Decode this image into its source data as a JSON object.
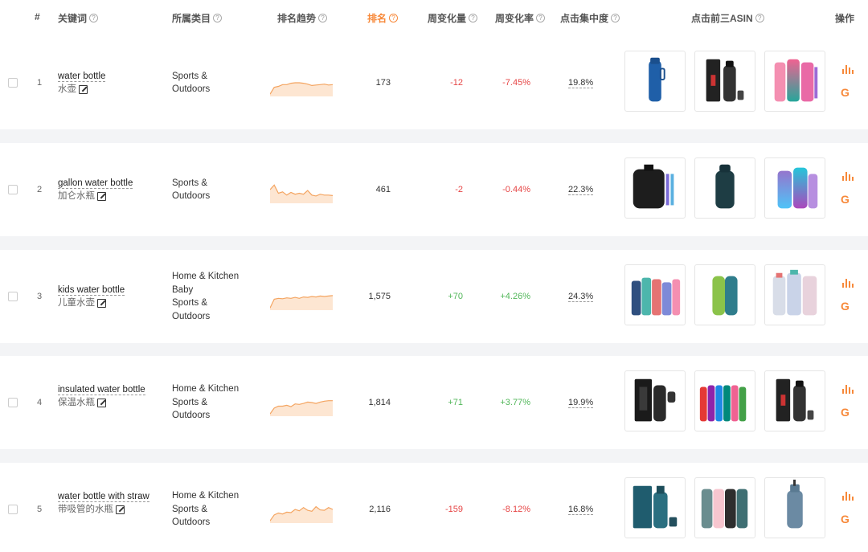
{
  "header": {
    "index": "#",
    "keyword": "关键词",
    "category": "所属类目",
    "trend": "排名趋势",
    "rank": "排名",
    "weekly_change": "周变化量",
    "weekly_rate": "周变化率",
    "click_concentration": "点击集中度",
    "top3_asin": "点击前三ASIN",
    "actions": "操作"
  },
  "icons": {
    "help": "question-circle-icon",
    "edit": "edit-icon",
    "chart": "bar-chart-icon",
    "google": "google-icon"
  },
  "colors": {
    "accent": "#f7893a",
    "negative": "#e64545",
    "positive": "#52b75a",
    "sparkline_stroke": "#f4a460",
    "sparkline_fill": "#fde6d2"
  },
  "rows": [
    {
      "index": "1",
      "keyword": "water bottle",
      "keyword_cn": "水壶",
      "categories": [
        "Sports &",
        "Outdoors"
      ],
      "trend": [
        55,
        40,
        38,
        34,
        34,
        31,
        30,
        30,
        31,
        33,
        36,
        35,
        34,
        33,
        35,
        34
      ],
      "rank": "173",
      "change": "-12",
      "rate": "-7.45%",
      "direction": "negative",
      "concentration": "19.8%",
      "thumbs": [
        "blue-bottle",
        "black-bottle-set",
        "pink-teal-bottles"
      ]
    },
    {
      "index": "2",
      "keyword": "gallon water bottle",
      "keyword_cn": "加仑水瓶",
      "categories": [
        "Sports &",
        "Outdoors"
      ],
      "trend": [
        30,
        20,
        38,
        35,
        42,
        36,
        40,
        38,
        40,
        32,
        42,
        44,
        40,
        42,
        42,
        43
      ],
      "rank": "461",
      "change": "-2",
      "rate": "-0.44%",
      "direction": "negative",
      "concentration": "22.3%",
      "thumbs": [
        "gallon-jug",
        "dark-teal-bottle",
        "gradient-bottles"
      ]
    },
    {
      "index": "3",
      "keyword": "kids water bottle",
      "keyword_cn": "儿童水壶",
      "categories": [
        "Home & Kitchen",
        "Baby",
        "Sports &",
        "Outdoors"
      ],
      "trend": [
        55,
        36,
        34,
        35,
        33,
        34,
        32,
        34,
        31,
        32,
        30,
        31,
        29,
        30,
        29,
        28
      ],
      "rank": "1,575",
      "change": "+70",
      "rate": "+4.26%",
      "direction": "positive",
      "concentration": "24.3%",
      "thumbs": [
        "kids-bottles",
        "green-bottle",
        "clear-kids-bottles"
      ]
    },
    {
      "index": "4",
      "keyword": "insulated water bottle",
      "keyword_cn": "保温水瓶",
      "categories": [
        "Home & Kitchen",
        "Sports &",
        "Outdoors"
      ],
      "trend": [
        55,
        42,
        38,
        38,
        36,
        39,
        33,
        34,
        32,
        29,
        30,
        32,
        29,
        27,
        26,
        26
      ],
      "rank": "1,814",
      "change": "+71",
      "rate": "+3.77%",
      "direction": "positive",
      "concentration": "19.9%",
      "thumbs": [
        "black-insulated",
        "color-bottles",
        "black-bottle-set"
      ]
    },
    {
      "index": "5",
      "keyword": "water bottle with straw",
      "keyword_cn": "带吸管的水瓶",
      "categories": [
        "Home & Kitchen",
        "Sports &",
        "Outdoors"
      ],
      "trend": [
        55,
        42,
        38,
        40,
        36,
        37,
        30,
        33,
        26,
        32,
        34,
        24,
        31,
        32,
        26,
        30
      ],
      "rank": "2,116",
      "change": "-159",
      "rate": "-8.12%",
      "direction": "negative",
      "concentration": "16.8%",
      "thumbs": [
        "teal-bottle-set",
        "pastel-bottles",
        "slate-blue-bottle"
      ]
    }
  ]
}
